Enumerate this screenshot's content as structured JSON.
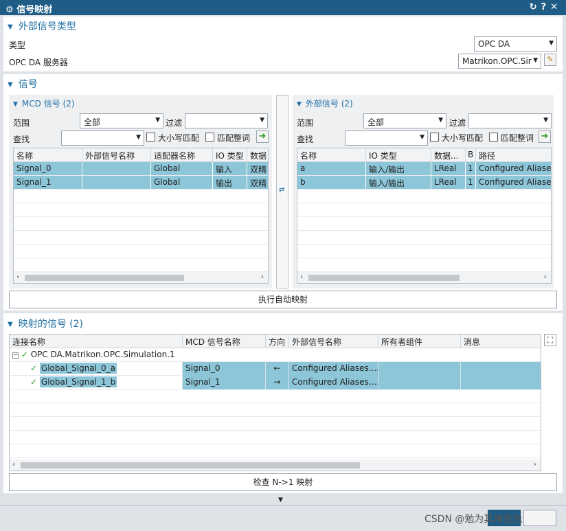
{
  "window": {
    "title": "信号映射",
    "icons": [
      "gear-icon",
      "reset-icon",
      "help-icon",
      "close-icon"
    ]
  },
  "external_type": {
    "header": "外部信号类型",
    "type_label": "类型",
    "type_value": "OPC DA",
    "server_label": "OPC DA 服务器",
    "server_value": "Matrikon.OPC.Sir"
  },
  "signals": {
    "header": "信号",
    "mcd": {
      "header": "MCD 信号 (2)",
      "scope_label": "范围",
      "scope_value": "全部",
      "filter_label": "过滤",
      "filter_value": "",
      "find_label": "查找",
      "find_value": "",
      "case_label": "大小写匹配",
      "whole_label": "匹配整词",
      "columns": [
        "名称",
        "外部信号名称",
        "适配器名称",
        "IO 类型",
        "数据"
      ],
      "rows": [
        [
          "Signal_0",
          "",
          "Global",
          "输入",
          "双精"
        ],
        [
          "Signal_1",
          "",
          "Global",
          "输出",
          "双精"
        ]
      ]
    },
    "ext": {
      "header": "外部信号 (2)",
      "scope_label": "范围",
      "scope_value": "全部",
      "filter_label": "过滤",
      "filter_value": "",
      "find_label": "查找",
      "find_value": "",
      "case_label": "大小写匹配",
      "whole_label": "匹配整词",
      "columns": [
        "名称",
        "IO 类型",
        "数据...",
        "B",
        "路径"
      ],
      "rows": [
        [
          "a",
          "输入/输出",
          "LReal",
          "1",
          "Configured Aliases"
        ],
        [
          "b",
          "输入/输出",
          "LReal",
          "1",
          "Configured Aliases"
        ]
      ]
    },
    "auto_map_button": "执行自动映射"
  },
  "mapped": {
    "header": "映射的信号 (2)",
    "columns": [
      "连接名称",
      "MCD 信号名称",
      "方向",
      "外部信号名称",
      "所有者组件",
      "消息"
    ],
    "root": "OPC DA.Matrikon.OPC.Simulation.1",
    "rows": [
      {
        "name": "Global_Signal_0_a",
        "mcd": "Signal_0",
        "dir": "←",
        "ext": "Configured Aliases....",
        "owner": "",
        "msg": ""
      },
      {
        "name": "Global_Signal_1_b",
        "mcd": "Signal_1",
        "dir": "→",
        "ext": "Configured Aliases....",
        "owner": "",
        "msg": ""
      }
    ],
    "check_button": "检查 N->1 映射"
  },
  "footer": {
    "watermark": "CSDN @勉为其难免免"
  }
}
